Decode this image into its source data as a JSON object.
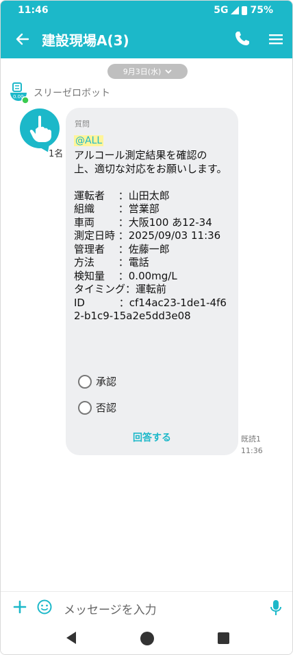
{
  "status_bar": {
    "time": "11:46",
    "network": "5G",
    "battery": "75%"
  },
  "app_bar": {
    "title": "建設現場A(3)"
  },
  "chat": {
    "date_chip": "9月3日(水)",
    "sender_name": "スリーゼロボット",
    "count_label": "1名",
    "message": {
      "category": "質問",
      "mention": "@ALL",
      "body": "アルコール測定結果を確認の上、適切な対応をお願いします。\n\n運転者　 ：山田太郎\n組織　　 ：営業部\n車両　　 ：大阪100 あ12-34\n測定日時 ：2025/09/03 11:36\n管理者　 ：佐藤一郎\n方法　　 ：電話\n検知量　 ：0.00mg/L\nタイミング：運転前\nID　　　 ：cf14ac23-1de1-4f62-b1c9-15a2e5dd3e08",
      "options": [
        "承認",
        "否認"
      ],
      "answer_label": "回答する"
    },
    "read_status": "既読1",
    "sent_time": "11:36"
  },
  "input": {
    "placeholder": "メッセージを入力"
  },
  "colors": {
    "accent": "#1cb8c9",
    "mention_highlight": "#fff59a",
    "bubble": "#eeeff1"
  },
  "icons": [
    "back-arrow-icon",
    "phone-icon",
    "menu-icon",
    "chevron-down-icon",
    "plus-icon",
    "emoji-icon",
    "mic-icon"
  ]
}
